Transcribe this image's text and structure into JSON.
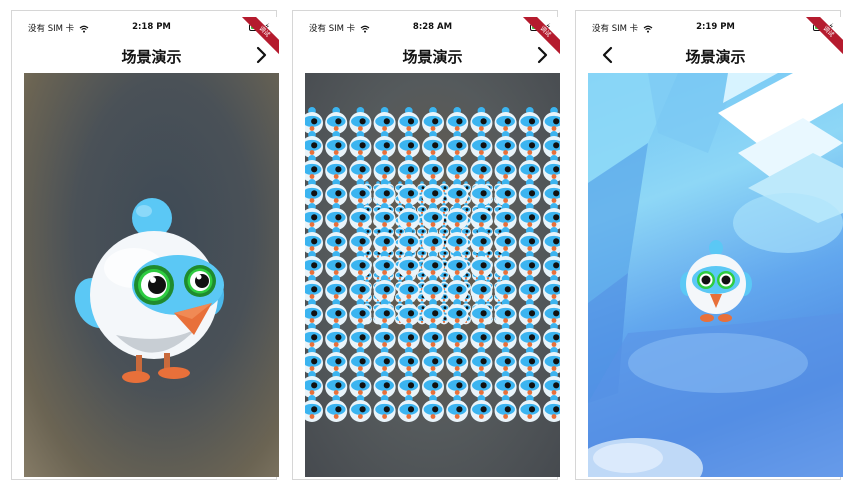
{
  "screens": [
    {
      "carrier": "没有 SIM 卡",
      "time": "2:18 PM",
      "title": "场景演示",
      "nav_icon": "chevron-right-icon",
      "scene": "single-bird"
    },
    {
      "carrier": "没有 SIM 卡",
      "time": "8:28 AM",
      "title": "场景演示",
      "nav_icon": "chevron-right-icon",
      "scene": "bird-grid"
    },
    {
      "carrier": "没有 SIM 卡",
      "time": "2:19 PM",
      "title": "场景演示",
      "nav_icon": "chevron-left-icon",
      "scene": "ice-cave-bird"
    }
  ],
  "debug_banner": "调试",
  "colors": {
    "bird_body": "#ffffff",
    "bird_blue": "#5bc8f5",
    "eye_ring": "#2ecc40",
    "beak": "#e8703a",
    "feet": "#e8703a",
    "debug_ribbon": "#b51b2e",
    "battery": "#2ecc40"
  }
}
